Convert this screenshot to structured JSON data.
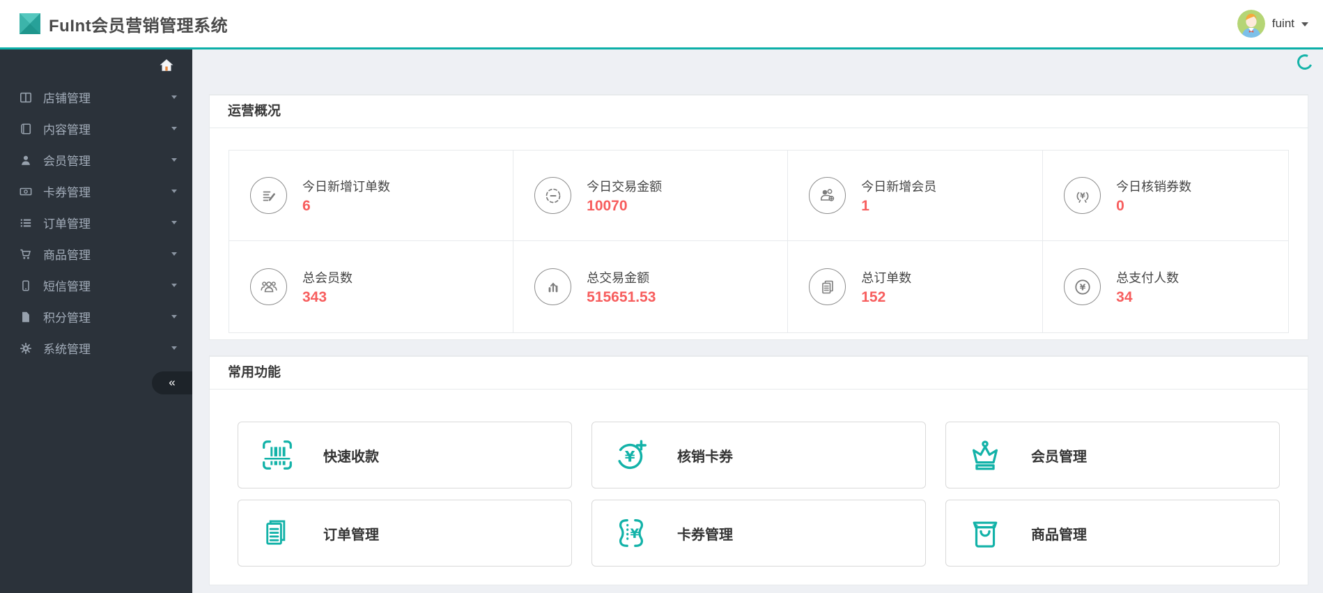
{
  "header": {
    "title": "FuInt会员营销管理系统",
    "user": {
      "name": "fuint"
    }
  },
  "sidebar": {
    "collapse_glyph": "«",
    "items": [
      {
        "label": "店铺管理",
        "icon": "store-icon"
      },
      {
        "label": "内容管理",
        "icon": "book-icon"
      },
      {
        "label": "会员管理",
        "icon": "user-icon"
      },
      {
        "label": "卡券管理",
        "icon": "money-bill-icon"
      },
      {
        "label": "订单管理",
        "icon": "list-icon"
      },
      {
        "label": "商品管理",
        "icon": "cart-icon"
      },
      {
        "label": "短信管理",
        "icon": "mobile-icon"
      },
      {
        "label": "积分管理",
        "icon": "file-icon"
      },
      {
        "label": "系统管理",
        "icon": "gear-icon"
      }
    ]
  },
  "overview": {
    "title": "运营概况",
    "value_color": "#f75d5d",
    "stats": [
      {
        "label": "今日新增订单数",
        "value": "6",
        "icon": "new-orders-icon"
      },
      {
        "label": "今日交易金额",
        "value": "10070",
        "icon": "today-amount-icon"
      },
      {
        "label": "今日新增会员",
        "value": "1",
        "icon": "new-member-icon"
      },
      {
        "label": "今日核销券数",
        "value": "0",
        "icon": "verified-coupons-icon"
      },
      {
        "label": "总会员数",
        "value": "343",
        "icon": "total-members-icon"
      },
      {
        "label": "总交易金额",
        "value": "515651.53",
        "icon": "total-amount-icon"
      },
      {
        "label": "总订单数",
        "value": "152",
        "icon": "total-orders-icon"
      },
      {
        "label": "总支付人数",
        "value": "34",
        "icon": "total-payers-icon"
      }
    ]
  },
  "quick_actions": {
    "title": "常用功能",
    "accent_color": "#12b2a8",
    "items": [
      {
        "label": "快速收款",
        "icon": "scan-pay-icon"
      },
      {
        "label": "核销卡券",
        "icon": "verify-coupon-icon"
      },
      {
        "label": "会员管理",
        "icon": "member-crown-icon"
      },
      {
        "label": "订单管理",
        "icon": "order-doc-icon"
      },
      {
        "label": "卡券管理",
        "icon": "coupon-ticket-icon"
      },
      {
        "label": "商品管理",
        "icon": "goods-bag-icon"
      }
    ]
  }
}
